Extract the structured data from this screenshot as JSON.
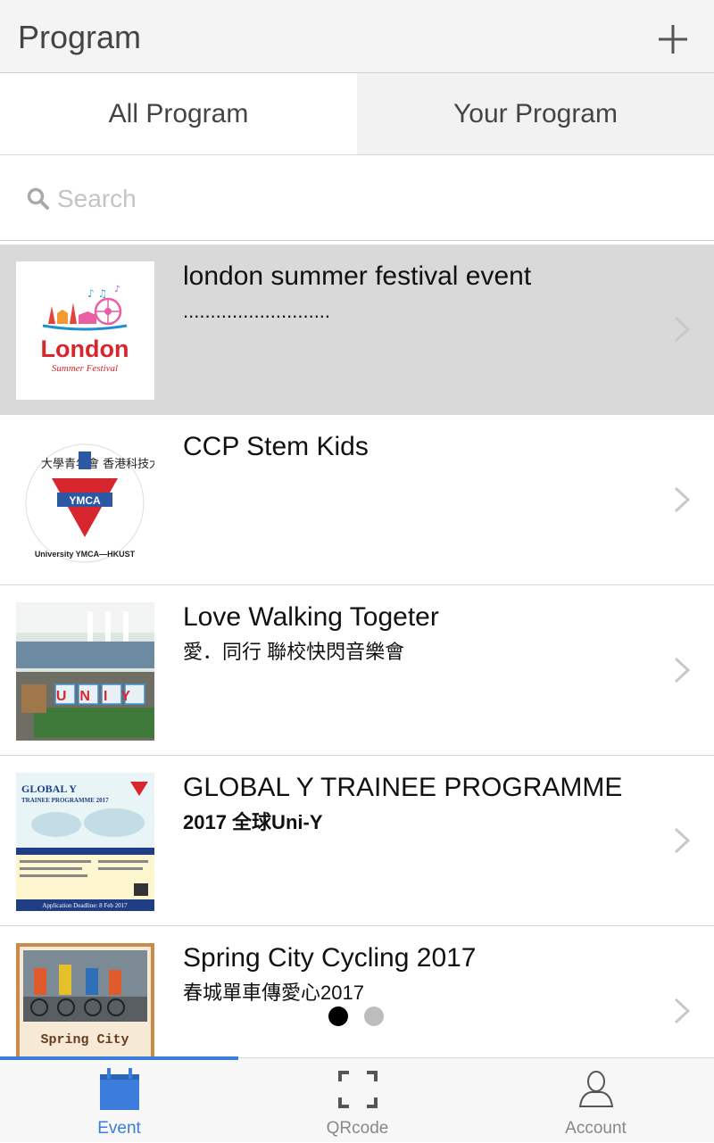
{
  "header": {
    "title": "Program",
    "add_icon": "plus-icon"
  },
  "tabs": [
    {
      "label": "All Program",
      "active": true
    },
    {
      "label": "Your Program",
      "active": false
    }
  ],
  "search": {
    "placeholder": "Search",
    "value": ""
  },
  "programs": [
    {
      "title": "london summer festival event",
      "subtitle": "...........................",
      "thumb_label": "London",
      "thumb_sublabel": "Summer Festival",
      "selected": true
    },
    {
      "title": "CCP Stem Kids",
      "subtitle": "",
      "thumb_label": "YMCA",
      "thumb_sublabel": "University YMCA—HKUST",
      "thumb_chinese": "大學青年會 香港科技大學",
      "selected": false
    },
    {
      "title": "Love Walking Togeter",
      "subtitle": "愛．同行 聯校快閃音樂會",
      "thumb_label": "UNIY",
      "selected": false
    },
    {
      "title": "GLOBAL Y TRAINEE PROGRAMME",
      "subtitle": "2017 全球Uni-Y",
      "thumb_label": "GLOBAL Y",
      "thumb_sublabel": "TRAINEE PROGRAMME 2017",
      "thumb_footer": "Application Deadline: 8 Feb 2017",
      "selected": false
    },
    {
      "title": "Spring City Cycling 2017",
      "subtitle": "春城單車傳愛心2017",
      "thumb_label": "Spring City",
      "selected": false
    }
  ],
  "pager": {
    "count": 2,
    "current": 1
  },
  "bottom_nav": [
    {
      "label": "Event",
      "icon": "calendar-icon",
      "active": true
    },
    {
      "label": "QRcode",
      "icon": "qr-scan-icon",
      "active": false
    },
    {
      "label": "Account",
      "icon": "user-icon",
      "active": false
    }
  ],
  "colors": {
    "accent": "#3b7ddd",
    "selected_row": "#d9d9d9",
    "header_bg": "#f4f4f4"
  }
}
